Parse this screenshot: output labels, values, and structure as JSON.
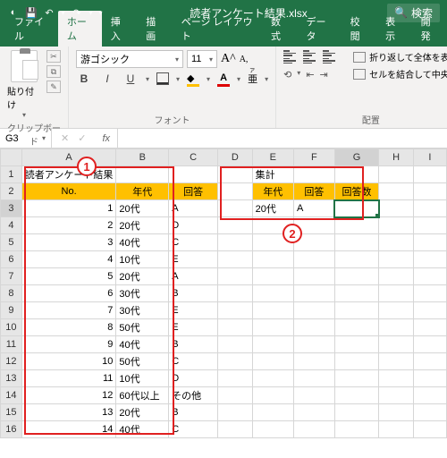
{
  "titlebar": {
    "filename": "読者アンケート結果.xlsx",
    "search": "検索"
  },
  "tabs": [
    "ファイル",
    "ホーム",
    "挿入",
    "描画",
    "ページ レイアウト",
    "数式",
    "データ",
    "校閲",
    "表示",
    "開発"
  ],
  "active_tab": 1,
  "ribbon": {
    "clipboard": {
      "paste": "貼り付け",
      "label": "クリップボード"
    },
    "font": {
      "name": "游ゴシック",
      "size": "11",
      "label": "フォント"
    },
    "align": {
      "wrap": "折り返して全体を表示",
      "merge": "セルを結合して中央揃",
      "label": "配置"
    }
  },
  "namebox": "G3",
  "cols": [
    "A",
    "B",
    "C",
    "D",
    "E",
    "F",
    "G",
    "H",
    "I"
  ],
  "left_title": "読者アンケート結果",
  "left_headers": [
    "No.",
    "年代",
    "回答"
  ],
  "left_rows": [
    {
      "no": 1,
      "age": "20代",
      "ans": "A"
    },
    {
      "no": 2,
      "age": "20代",
      "ans": "D"
    },
    {
      "no": 3,
      "age": "40代",
      "ans": "C"
    },
    {
      "no": 4,
      "age": "10代",
      "ans": "E"
    },
    {
      "no": 5,
      "age": "20代",
      "ans": "A"
    },
    {
      "no": 6,
      "age": "30代",
      "ans": "B"
    },
    {
      "no": 7,
      "age": "30代",
      "ans": "E"
    },
    {
      "no": 8,
      "age": "50代",
      "ans": "E"
    },
    {
      "no": 9,
      "age": "40代",
      "ans": "B"
    },
    {
      "no": 10,
      "age": "50代",
      "ans": "C"
    },
    {
      "no": 11,
      "age": "10代",
      "ans": "D"
    },
    {
      "no": 12,
      "age": "60代以上",
      "ans": "その他"
    },
    {
      "no": 13,
      "age": "20代",
      "ans": "B"
    },
    {
      "no": 14,
      "age": "40代",
      "ans": "C"
    }
  ],
  "right_title": "集計",
  "right_headers": [
    "年代",
    "回答",
    "回答数"
  ],
  "right_row": {
    "age": "20代",
    "ans": "A",
    "cnt": ""
  },
  "annot": {
    "b1": "1",
    "b2": "2"
  }
}
